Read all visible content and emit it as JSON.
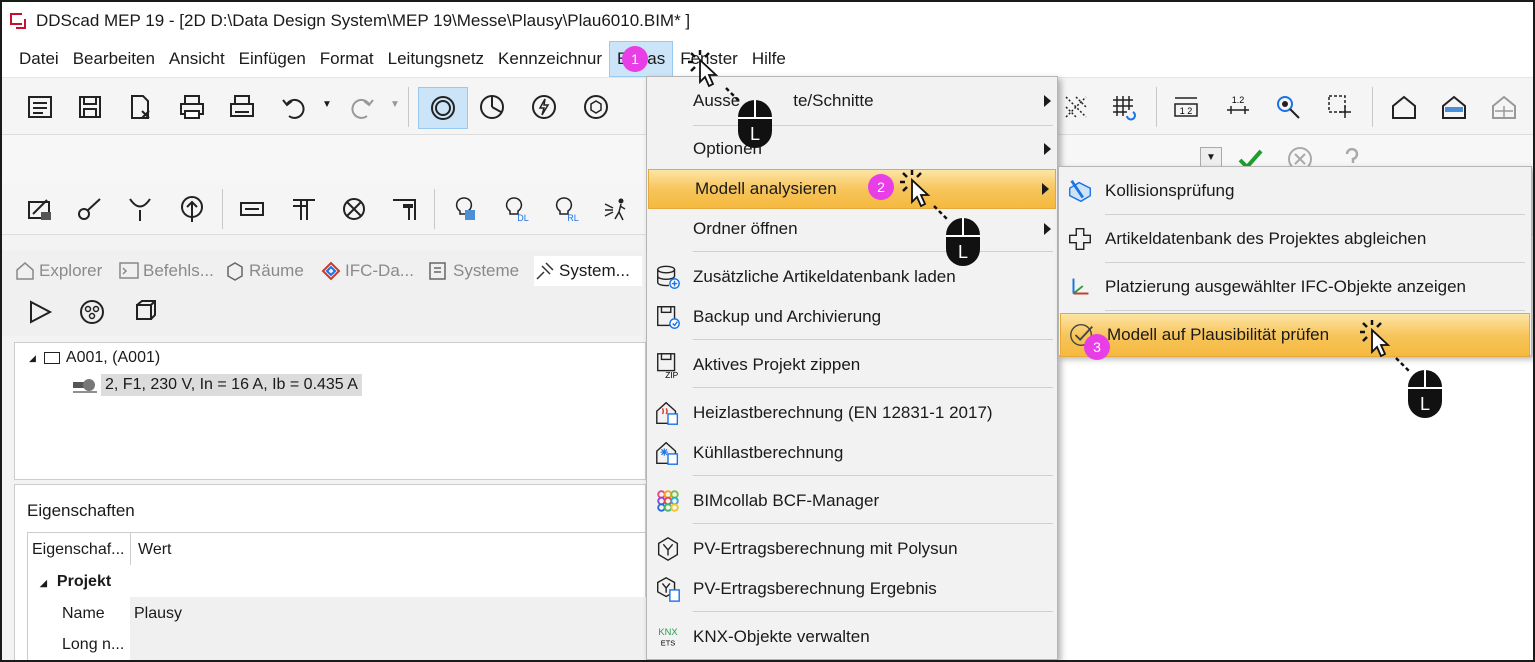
{
  "window": {
    "title": "DDScad MEP 19 - [2D  D:\\Data Design System\\MEP 19\\Messe\\Plausy\\Plau6010.BIM* ]"
  },
  "menubar": {
    "items": [
      "Datei",
      "Bearbeiten",
      "Ansicht",
      "Einfügen",
      "Format",
      "Leitungsnetz",
      "Kennzeichnur",
      "Extras",
      "Fenster",
      "Hilfe"
    ]
  },
  "tabs": [
    "Explorer",
    "Befehls...",
    "Räume",
    "IFC-Da...",
    "Systeme",
    "System..."
  ],
  "tree": {
    "root": "A001,  (A001)",
    "child": "2, F1, 230 V, In = 16 A, Ib = 0.435 A"
  },
  "properties": {
    "title": "Eigenschaften",
    "col_property": "Eigenschaf...",
    "col_value": "Wert",
    "group": "Projekt",
    "rows": [
      {
        "name": "Name",
        "value": "Plausy"
      },
      {
        "name": "Long n...",
        "value": ""
      }
    ]
  },
  "extras_menu": {
    "items": [
      "Aussen/Ansichte/Schnitte",
      "Optionen",
      "Modell analysieren",
      "Ordner öffnen",
      "Zusätzliche Artikeldatenbank laden",
      "Backup und Archivierung",
      "Aktives Projekt zippen",
      "Heizlastberechnung (EN 12831-1 2017)",
      "Kühllastberechnung",
      "BIMcollab BCF-Manager",
      "PV-Ertragsberechnung mit Polysun",
      "PV-Ertragsberechnung Ergebnis",
      "KNX-Objekte verwalten"
    ],
    "item0_visible": "Ausse",
    "item0_tail": "te/Schnitte",
    "knx_line1": "KNX",
    "knx_line2": "ETS",
    "zip_label": "ZIP"
  },
  "submenu": {
    "items": [
      "Kollisionsprüfung",
      "Artikeldatenbank des Projektes abgleichen",
      "Platzierung ausgewählter IFC-Objekte anzeigen",
      "Modell auf Plausibilität prüfen"
    ]
  },
  "steps": [
    "1",
    "2",
    "3"
  ],
  "mouse_button": "L",
  "toolbar_labels": {
    "dim1": "1 2",
    "dim2": "1.2",
    "dl": "DL",
    "rl": "RL"
  },
  "colors": {
    "highlight": "#f7c55c",
    "badge": "#e83ee6",
    "accent_red": "#c8102e",
    "select_blue": "#cce4f7"
  }
}
